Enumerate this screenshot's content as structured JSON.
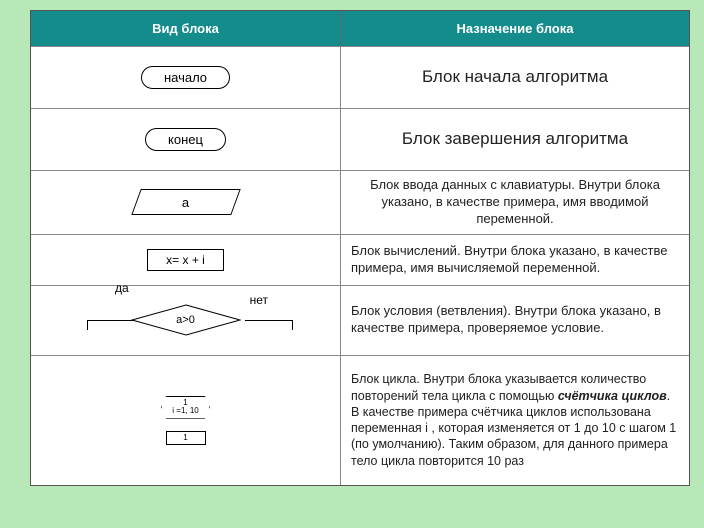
{
  "header": {
    "col1": "Вид блока",
    "col2": "Назначение блока"
  },
  "rows": [
    {
      "shapeText": "начало",
      "desc": "Блок начала алгоритма"
    },
    {
      "shapeText": "конец",
      "desc": "Блок завершения алгоритма"
    },
    {
      "shapeText": "a",
      "desc": "Блок ввода данных с клавиатуры. Внутри блока указано, в качестве примера, имя вводимой переменной."
    },
    {
      "shapeText": "x= x + i",
      "desc": "Блок вычислений. Внутри блока указано, в качестве примера, имя вычисляемой переменной."
    },
    {
      "shapeText": "a>0",
      "yes": "да",
      "no": "нет",
      "desc": "Блок условия (ветвления). Внутри блока указано, в качестве примера, проверяемое условие."
    },
    {
      "loopTop": "1",
      "loopText": "i =1, 10",
      "loopBody": "1",
      "desc": "Блок цикла. Внутри блока указывается количество повторений тела цикла с помощью счётчика циклов. В качестве примера счётчика циклов использована переменная i , которая изменяется от 1 до 10 с шагом 1 (по умолчанию). Таким образом, для данного примера тело цикла повторится 10 раз"
    }
  ]
}
